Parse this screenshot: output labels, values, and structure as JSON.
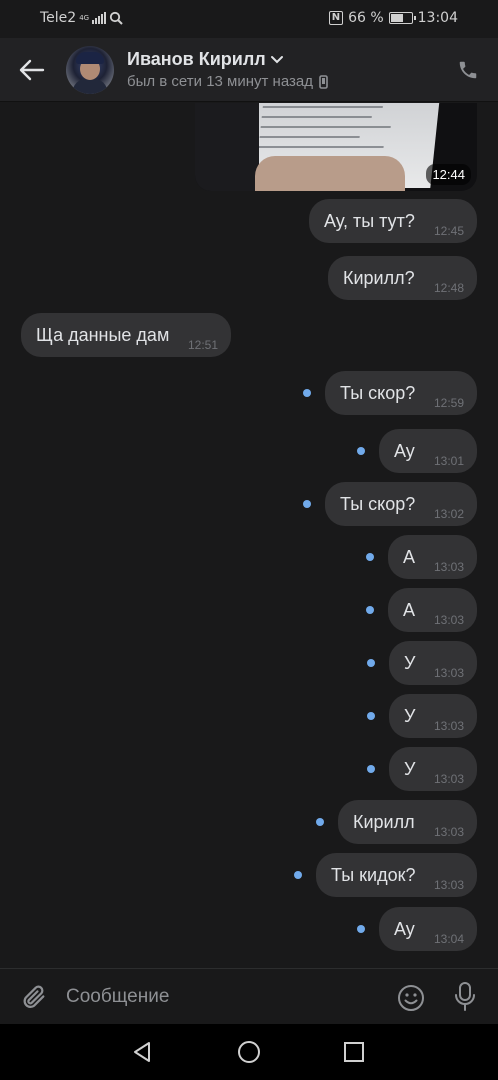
{
  "status_bar": {
    "carrier": "Tele2",
    "network": "4G",
    "nfc": "N",
    "battery_percent": "66 %",
    "battery_level": 0.66,
    "time": "13:04"
  },
  "header": {
    "contact_name": "Иванов Кирилл",
    "last_seen": "был в сети 13 минут назад"
  },
  "photo_message": {
    "time": "12:44"
  },
  "messages": [
    {
      "text": "Ау, ты тут?",
      "time": "12:45",
      "direction": "out",
      "unread": false
    },
    {
      "text": "Кирилл?",
      "time": "12:48",
      "direction": "out",
      "unread": false
    },
    {
      "text": "Ща данные дам",
      "time": "12:51",
      "direction": "in",
      "unread": false
    },
    {
      "text": "Ты скор?",
      "time": "12:59",
      "direction": "out",
      "unread": true
    },
    {
      "text": "Ау",
      "time": "13:01",
      "direction": "out",
      "unread": true
    },
    {
      "text": "Ты скор?",
      "time": "13:02",
      "direction": "out",
      "unread": true
    },
    {
      "text": "А",
      "time": "13:03",
      "direction": "out",
      "unread": true
    },
    {
      "text": "А",
      "time": "13:03",
      "direction": "out",
      "unread": true
    },
    {
      "text": "У",
      "time": "13:03",
      "direction": "out",
      "unread": true
    },
    {
      "text": "У",
      "time": "13:03",
      "direction": "out",
      "unread": true
    },
    {
      "text": "У",
      "time": "13:03",
      "direction": "out",
      "unread": true
    },
    {
      "text": "Кирилл",
      "time": "13:03",
      "direction": "out",
      "unread": true
    },
    {
      "text": "Ты кидок?",
      "time": "13:03",
      "direction": "out",
      "unread": true
    },
    {
      "text": "Ау",
      "time": "13:04",
      "direction": "out",
      "unread": true
    }
  ],
  "composer": {
    "placeholder": "Сообщение"
  },
  "colors": {
    "background": "#19191a",
    "bubble": "#333335",
    "unread_dot": "#71aaeb",
    "text": "#e1e3e6",
    "secondary_text": "#8e9094"
  },
  "icons": {
    "back": "arrow-left-icon",
    "dropdown": "chevron-down-icon",
    "device": "phone-device-icon",
    "call": "phone-call-icon",
    "attach": "paperclip-icon",
    "emoji": "smile-icon",
    "mic": "microphone-icon"
  }
}
